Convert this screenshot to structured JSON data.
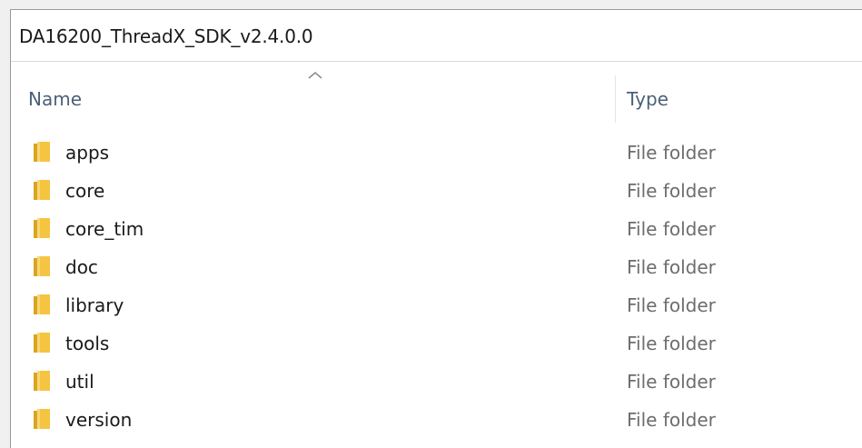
{
  "address_bar": {
    "path": "DA16200_ThreadX_SDK_v2.4.0.0"
  },
  "columns": {
    "name": "Name",
    "type": "Type",
    "sorted_column": "Name",
    "sort_indicator": "chevron-up-icon"
  },
  "colors": {
    "folder": "#f5c542",
    "folder_shadow": "#d9a521",
    "header_text": "#4c607a"
  },
  "files": [
    {
      "name": "apps",
      "type": "File folder",
      "icon": "folder-icon"
    },
    {
      "name": "core",
      "type": "File folder",
      "icon": "folder-icon"
    },
    {
      "name": "core_tim",
      "type": "File folder",
      "icon": "folder-icon"
    },
    {
      "name": "doc",
      "type": "File folder",
      "icon": "folder-icon"
    },
    {
      "name": "library",
      "type": "File folder",
      "icon": "folder-icon"
    },
    {
      "name": "tools",
      "type": "File folder",
      "icon": "folder-icon"
    },
    {
      "name": "util",
      "type": "File folder",
      "icon": "folder-icon"
    },
    {
      "name": "version",
      "type": "File folder",
      "icon": "folder-icon"
    }
  ]
}
